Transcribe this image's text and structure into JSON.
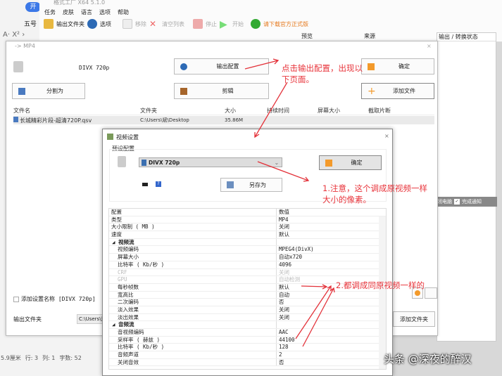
{
  "word": {
    "tab": "开",
    "font_size": "五号",
    "status": {
      "pos": "5.9厘米",
      "row": "行: 3",
      "col": "列: 1",
      "words": "字数: 52"
    }
  },
  "app": {
    "title": "格式工厂 X64 5.1.0",
    "menu": [
      "任务",
      "皮肤",
      "语言",
      "选项",
      "帮助"
    ],
    "toolbar": {
      "output_folder": "输出文件夹",
      "options": "选项",
      "remove": "移除",
      "clear": "清空列表",
      "stop": "停止",
      "start": "开始",
      "download": "请下载官方正式版"
    },
    "columns": [
      "预览",
      "来源",
      "输出 / 转换状态"
    ],
    "bottom": {
      "shutdown": "闭电脑",
      "notify": "完成通知"
    }
  },
  "mp4": {
    "title": "-> MP4",
    "preset": "DIVX 720p",
    "output_config": "输出配置",
    "ok": "确定",
    "split": "分割为",
    "clip": "剪辑",
    "add_file": "添加文件",
    "columns": [
      "文件名",
      "文件夹",
      "大小",
      "持续时间",
      "屏幕大小",
      "截取片断"
    ],
    "files": [
      {
        "name": "长城精彩片段-超清720P.qsv",
        "folder": "C:\\Users\\斌\\Desktop",
        "size": "35.86M",
        "duration": "",
        "screen": "",
        "clip": ""
      }
    ],
    "add_setting_name": "添加设置名称 [DIVX 720p]",
    "output_folder_label": "输出文件夹",
    "output_folder_value": "C:\\Users\\斌",
    "add_folder": "添加文件夹"
  },
  "vs": {
    "title": "视频设置",
    "preset_group": "预设配置",
    "preset": "DIVX 720p",
    "ok": "确定",
    "save_as": "另存为",
    "header": {
      "k": "配置",
      "v": "数值"
    },
    "rows": [
      {
        "k": "类型",
        "v": "MP4",
        "t": ""
      },
      {
        "k": "大小限制 ( MB )",
        "v": "关闭",
        "t": ""
      },
      {
        "k": "速度",
        "v": "默认",
        "t": ""
      },
      {
        "k": "视频流",
        "v": "",
        "t": "grp"
      },
      {
        "k": "视频编码",
        "v": "MPEG4(DivX)",
        "t": "ind"
      },
      {
        "k": "屏幕大小",
        "v": "自动x720",
        "t": "ind"
      },
      {
        "k": "比特率 ( Kb/秒 )",
        "v": "4096",
        "t": "ind"
      },
      {
        "k": "CRF",
        "v": "关闭",
        "t": "ind off"
      },
      {
        "k": "GPU",
        "v": "自动检测",
        "t": "ind off"
      },
      {
        "k": "每秒帧数",
        "v": "默认",
        "t": "ind"
      },
      {
        "k": "宽高比",
        "v": "自动",
        "t": "ind"
      },
      {
        "k": "二次编码",
        "v": "否",
        "t": "ind"
      },
      {
        "k": "淡入效果",
        "v": "关闭",
        "t": "ind"
      },
      {
        "k": "淡出效果",
        "v": "关闭",
        "t": "ind"
      },
      {
        "k": "音频流",
        "v": "",
        "t": "grp"
      },
      {
        "k": "音视频编码",
        "v": "AAC",
        "t": "ind"
      },
      {
        "k": "采样率 ( 赫兹 )",
        "v": "44100",
        "t": "ind"
      },
      {
        "k": "比特率 ( Kb/秒 )",
        "v": "128",
        "t": "ind"
      },
      {
        "k": "音频声道",
        "v": "2",
        "t": "ind"
      },
      {
        "k": "关闭音效",
        "v": "否",
        "t": "ind"
      }
    ]
  },
  "annotations": {
    "a1": "点击输出配置，出现以下页面。",
    "a2": "1.注意，这个调成原视频一样大小的像素。",
    "a3": "2.都调成同原视频一样的"
  },
  "watermark": "头条 @深夜的醉汉"
}
